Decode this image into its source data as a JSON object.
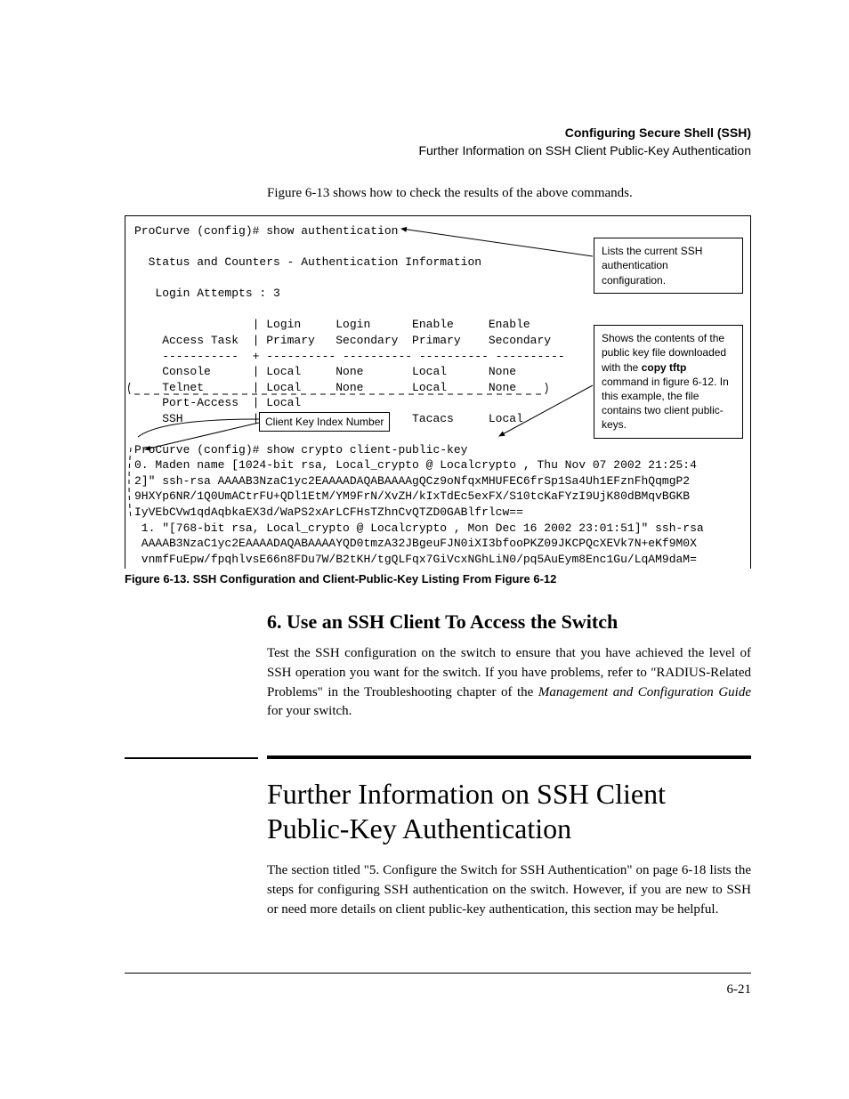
{
  "header": {
    "title": "Configuring Secure Shell (SSH)",
    "subtitle": "Further Information on SSH Client Public-Key Authentication"
  },
  "intro": "Figure 6-13 shows how to check the results of the above commands.",
  "terminal": {
    "cmd1": "ProCurve (config)# show authentication",
    "status_line": "  Status and Counters - Authentication Information",
    "login_attempts": "   Login Attempts : 3",
    "hdr": "                 | Login     Login      Enable     Enable",
    "hdr2": "    Access Task  | Primary   Secondary  Primary    Secondary",
    "divider": "    -----------  + ---------- ---------- ---------- ----------",
    "row_console": "    Console      | Local     None       Local      None",
    "row_telnet": "    Telnet       | Local     None       Local      None",
    "row_port": "    Port-Access  | Local",
    "row_ssh": "    SSH          | PublicKey None       Tacacs     Local",
    "cmd2": "ProCurve (config)# show crypto client-public-key",
    "key0_a": "0. Maden name [1024-bit rsa, Local_crypto @ Localcrypto , Thu Nov 07 2002 21:25:4",
    "key0_b": "2]\" ssh-rsa AAAAB3NzaC1yc2EAAAADAQABAAAAgQCz9oNfqxMHUFEC6frSp1Sa4Uh1EFznFhQqmgP2",
    "key0_c": "9HXYp6NR/1Q0UmACtrFU+QDl1EtM/YM9FrN/XvZH/kIxTdEc5exFX/S10tcKaFYzI9UjK80dBMqvBGKB",
    "key0_d": "IyVEbCVw1qdAqbkaEX3d/WaPS2xArLCFHsTZhnCvQTZD0GABlfrlcw==",
    "key1_a": " 1. \"[768-bit rsa, Local_crypto @ Localcrypto , Mon Dec 16 2002 23:01:51]\" ssh-rsa",
    "key1_b": " AAAAB3NzaC1yc2EAAAADAQABAAAAYQD0tmzA32JBgeuFJN0iXI3bfooPKZ09JKCPQcXEVk7N+eKf9M0X",
    "key1_c": " vnmfFuEpw/fpqhlvsE66n8FDu7W/B2tKH/tgQLFqx7GiVcxNGhLiN0/pq5AuEym8Enc1Gu/LqAM9daM="
  },
  "callouts": {
    "top": "Lists the current SSH authentication configuration.",
    "mid_a": "Shows the contents of the public key file downloaded with the ",
    "mid_bold": "copy tftp",
    "mid_b": " command in figure 6-12. In this example, the file contains two client public-keys.",
    "index_label": "Client Key Index Number"
  },
  "figure_caption": "Figure 6-13. SSH Configuration and Client-Public-Key Listing From Figure 6-12",
  "section6": {
    "title": "6. Use an SSH Client To Access the Switch",
    "body_a": "Test the SSH configuration on the switch to ensure that you have achieved the level of SSH operation you want for the switch. If you have problems, refer to \"RADIUS-Related Problems\" in the Troubleshooting chapter of the ",
    "body_i": "Management and Configuration Guide",
    "body_b": " for your switch."
  },
  "main": {
    "title": "Further Information on SSH Client Public-Key Authentication",
    "body": "The section titled \"5. Configure the Switch for SSH Authentication\" on page 6-18 lists the steps for configuring SSH authentication on the switch. However, if you are new to SSH or need more details on client public-key authentication, this section may be helpful."
  },
  "page_number": "6-21"
}
